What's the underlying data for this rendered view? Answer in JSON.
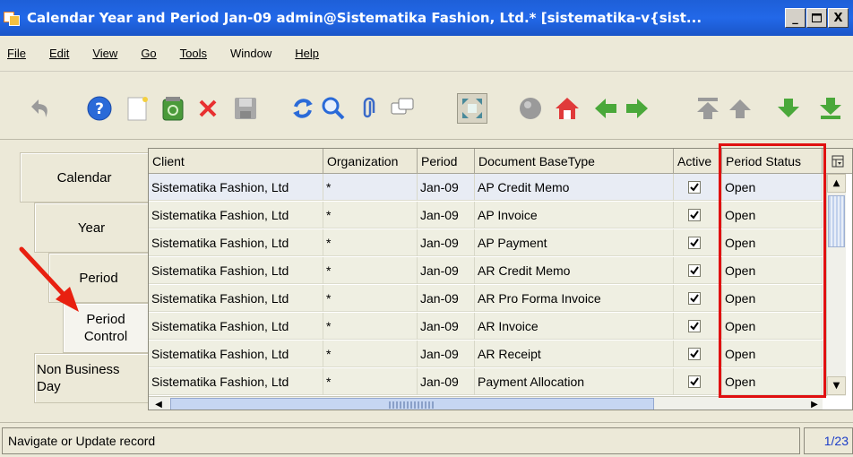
{
  "window": {
    "title": "Calendar Year and Period  Jan-09  admin@Sistematika Fashion, Ltd.* [sistematika-v{sist...",
    "controls": [
      "_",
      "□",
      "X"
    ]
  },
  "menu": [
    {
      "label": "File"
    },
    {
      "label": "Edit"
    },
    {
      "label": "View"
    },
    {
      "label": "Go"
    },
    {
      "label": "Tools"
    },
    {
      "label": "Window"
    },
    {
      "label": "Help"
    }
  ],
  "toolbar": [
    "undo-icon",
    "help-icon",
    "new-record-icon",
    "copy-record-icon",
    "delete-icon",
    "save-icon",
    "refresh-icon",
    "find-icon",
    "attachment-icon",
    "chat-icon",
    "zoom-icon",
    "archive-icon",
    "home-icon",
    "back-icon",
    "forward-icon",
    "first-record-icon",
    "previous-record-icon",
    "next-record-icon",
    "last-record-icon"
  ],
  "tabs": [
    {
      "label": "Calendar"
    },
    {
      "label": "Year"
    },
    {
      "label": "Period"
    },
    {
      "label": "Period Control"
    },
    {
      "label": "Non Business Day"
    }
  ],
  "table": {
    "columns": [
      "Client",
      "Organization",
      "Period",
      "Document BaseType",
      "Active",
      "Period Status"
    ],
    "rows": [
      {
        "client": "Sistematika Fashion, Ltd",
        "org": "*",
        "period": "Jan-09",
        "doctype": "AP Credit Memo",
        "active": true,
        "status": "Open"
      },
      {
        "client": "Sistematika Fashion, Ltd",
        "org": "*",
        "period": "Jan-09",
        "doctype": "AP Invoice",
        "active": true,
        "status": "Open"
      },
      {
        "client": "Sistematika Fashion, Ltd",
        "org": "*",
        "period": "Jan-09",
        "doctype": "AP Payment",
        "active": true,
        "status": "Open"
      },
      {
        "client": "Sistematika Fashion, Ltd",
        "org": "*",
        "period": "Jan-09",
        "doctype": "AR Credit Memo",
        "active": true,
        "status": "Open"
      },
      {
        "client": "Sistematika Fashion, Ltd",
        "org": "*",
        "period": "Jan-09",
        "doctype": "AR Pro Forma Invoice",
        "active": true,
        "status": "Open"
      },
      {
        "client": "Sistematika Fashion, Ltd",
        "org": "*",
        "period": "Jan-09",
        "doctype": "AR Invoice",
        "active": true,
        "status": "Open"
      },
      {
        "client": "Sistematika Fashion, Ltd",
        "org": "*",
        "period": "Jan-09",
        "doctype": "AR Receipt",
        "active": true,
        "status": "Open"
      },
      {
        "client": "Sistematika Fashion, Ltd",
        "org": "*",
        "period": "Jan-09",
        "doctype": "Payment Allocation",
        "active": true,
        "status": "Open"
      }
    ]
  },
  "status": {
    "message": "Navigate or Update record",
    "record_count": "1/23"
  },
  "colors": {
    "title_bar": "#2268e8",
    "highlight_box": "#e01010",
    "annotation_arrow": "#e82010"
  }
}
